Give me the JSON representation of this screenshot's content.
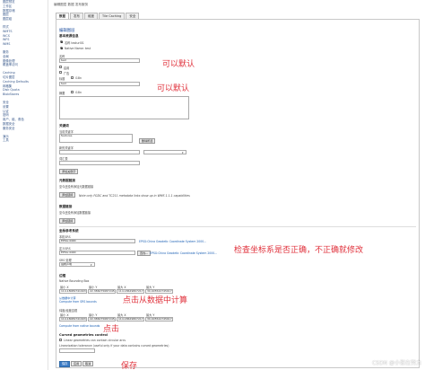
{
  "sidebar": {
    "items": [
      "图层预览",
      "工作区",
      "数据存储",
      "图层",
      "图层组",
      "样式",
      "WMTS",
      "WCS",
      "WFS",
      "WMS",
      "服务",
      "全局",
      "图像处理",
      "覆盖率访问",
      "Caching",
      "切片图层",
      "Caching Defaults",
      "网格集",
      "Disk Quota",
      "BlobStores",
      "安全",
      "设置",
      "认证",
      "密码",
      "用户、组、角色",
      "数据安全",
      "服务安全",
      "演示",
      "工具"
    ]
  },
  "header": {
    "crumb": "编辑图层 数据 发布服务"
  },
  "tabs": [
    "数据",
    "发布",
    "维度",
    "Tile Caching",
    "安全"
  ],
  "form": {
    "edit_layer": "编辑图层",
    "basic_info": "基本资源信息",
    "native_label": "名称  testurl01",
    "native_name": "Native Name: test",
    "name_label": "名称",
    "name_value": "test",
    "enabled_label": "启用",
    "advertised_label": "广告",
    "title_label": "标题",
    "title_value": "test",
    "title_i18n": "i18n",
    "abstract_label": "摘要",
    "abstract_i18n": "i18n",
    "keywords_heading": "关键词",
    "current_keywords": "当前关键字",
    "keywords_value": "features",
    "remove_selected": "删除所选",
    "new_keyword": "新的关键字",
    "vocabulary": "词汇表",
    "add_keyword": "添加关键字",
    "metadata_links": "元数据链接",
    "metadata_note": "至今还没有添加元数据链接",
    "add_link": "添加链接",
    "metadata_warning": "Note only FGDC and TC211 metadata links show up in WMS 1.1.1 capabilities",
    "data_links": "数据链接",
    "data_note": "至今还没有添加数据链接",
    "add_link2": "添加链接",
    "crs_heading": "坐标参考系统",
    "native_srs": "本机SRS",
    "native_srs_value": "EPSG:4490",
    "native_srs_link": "EPSG:China Geodetic Coordinate System 2000...",
    "declared_srs": "定义SRS",
    "declared_srs_value": "EPSG:4490",
    "find_button": "查找...",
    "declared_srs_link": "EPSG:China Geodetic Coordinate System 2000...",
    "srs_handling": "SRS 处理",
    "srs_handling_value": "强制声明",
    "bbox_heading": "边框",
    "native_bbox": "Native Bounding Box",
    "min_x": "最小 X",
    "min_y": "最小 Y",
    "max_x": "最大 X",
    "max_y": "最大 Y",
    "bbox_values": [
      "114.18089741903",
      "22.386075687245",
      "114.18629807217",
      "30.405542745617"
    ],
    "compute_from_data": "从数据中计算",
    "compute_from_srs": "Compute from SRS bounds",
    "latlon_bbox": "纬度/经度边框",
    "latlon_values": [
      "114.18089741903",
      "22.386075687245",
      "114.18629807217",
      "30.405542745617"
    ],
    "compute_native": "Compute from native bounds",
    "curved_heading": "Curved geometries control",
    "curved_check": "Linear geometries can contain circular arcs",
    "tolerance_label": "Linearization tolerance (useful only if your data contains curved geometries)",
    "save": "保存",
    "apply": "应用",
    "cancel": "取消"
  },
  "annotations": {
    "default1": "可以默认",
    "default2": "可以默认",
    "check_crs": "检查坐标系是否正确，不正确就修改",
    "compute": "点击从数据中计算",
    "click": "点击",
    "save": "保存"
  },
  "watermark": "CSDN @小张在努力"
}
